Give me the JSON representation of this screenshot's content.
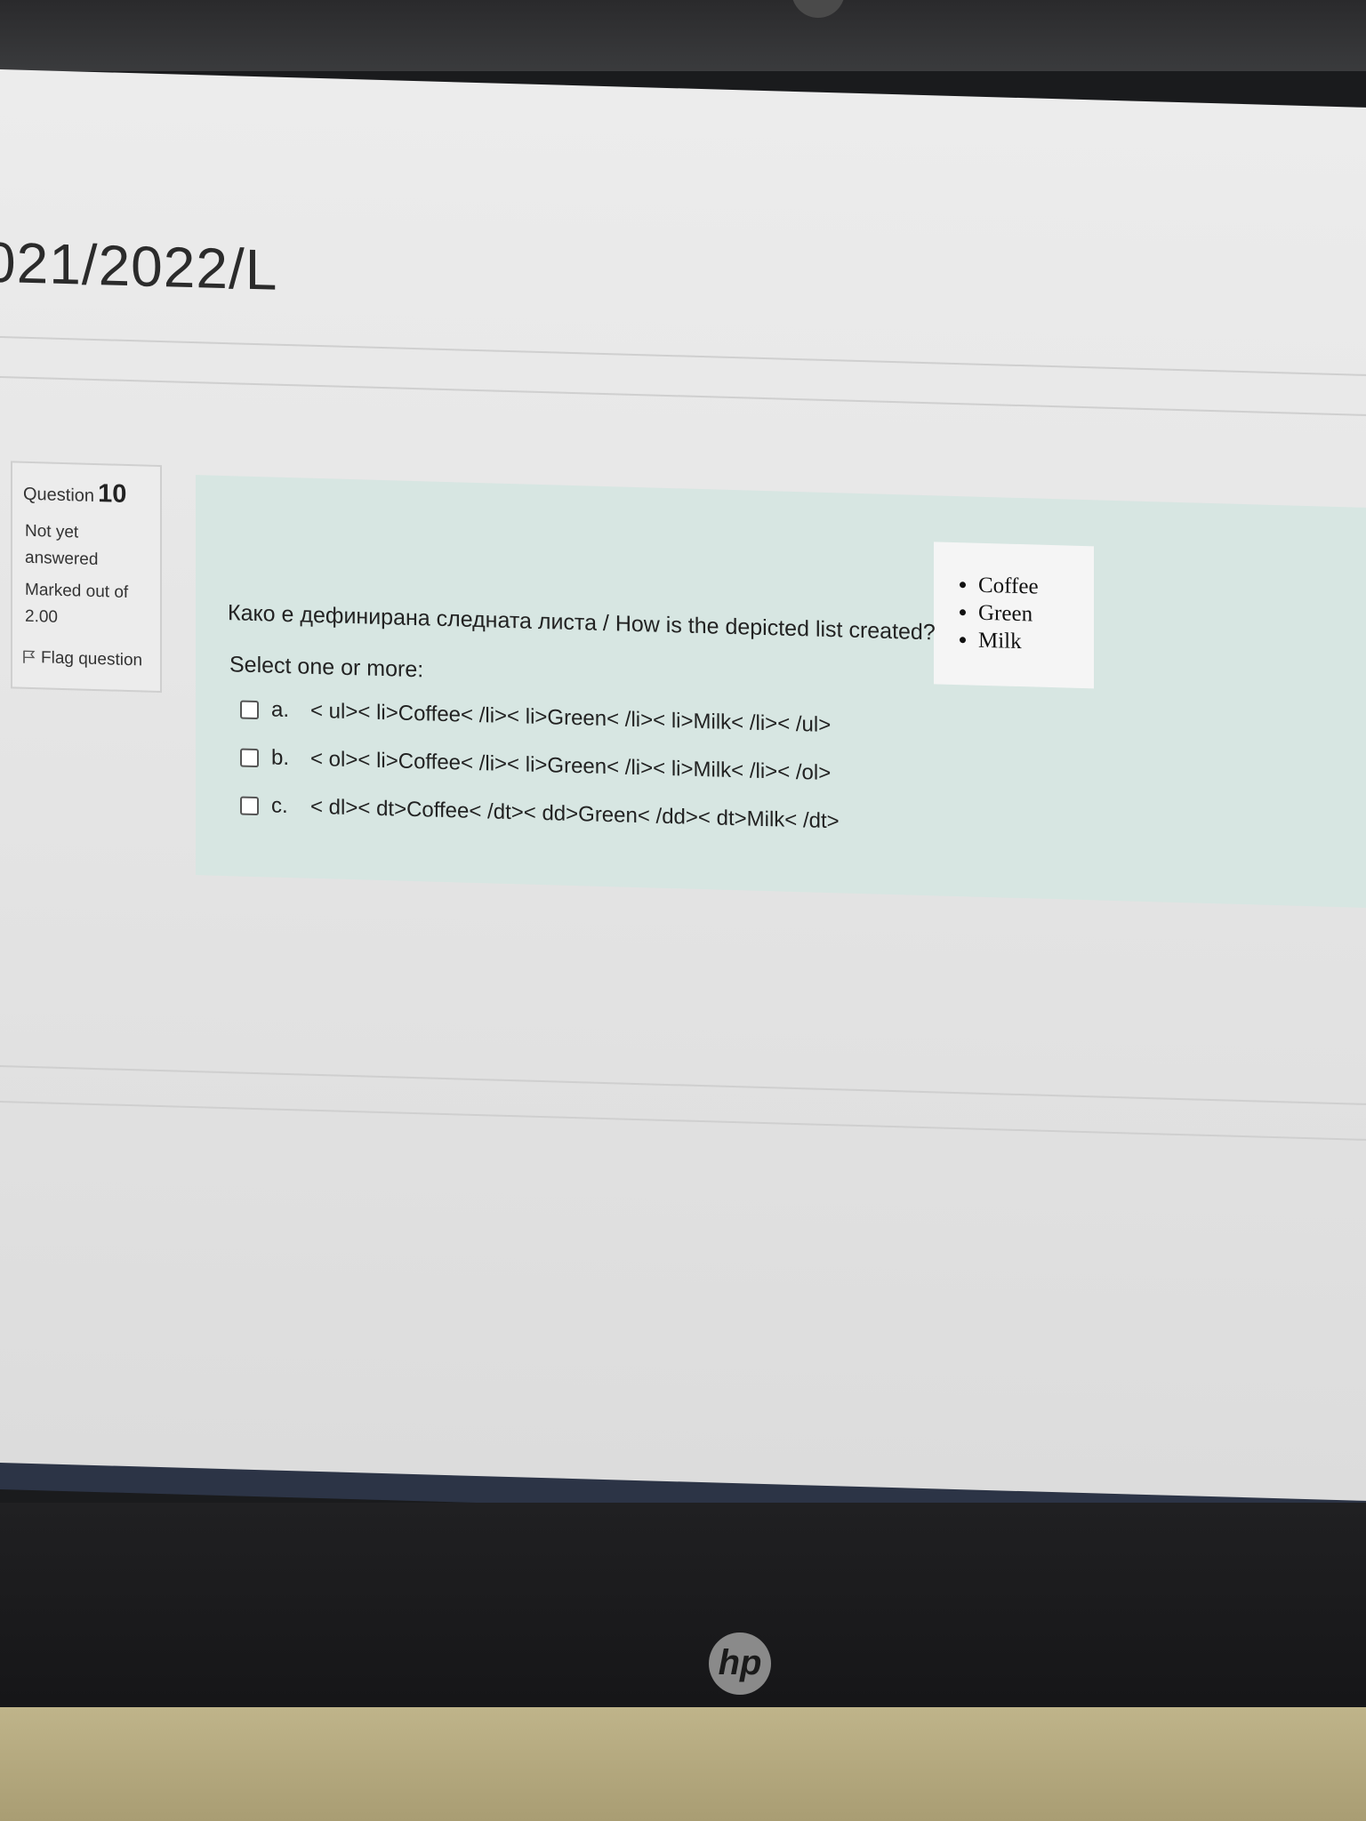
{
  "course": {
    "title_fragment": "021/2022/L"
  },
  "question_info": {
    "label": "Question",
    "number": "10",
    "state_line1": "Not yet",
    "state_line2": "answered",
    "grade_line1": "Marked out of",
    "grade_line2": "2.00",
    "flag_label": "Flag question"
  },
  "question": {
    "prompt": "Како е дефинирана следната листа / How is the depicted list created?",
    "depicted_list": [
      "Coffee",
      "Green",
      "Milk"
    ],
    "select_label": "Select one or more:",
    "answers": [
      {
        "letter": "a.",
        "text": "< ul>< li>Coffee< /li>< li>Green< /li>< li>Milk< /li>< /ul>",
        "checked": false
      },
      {
        "letter": "b.",
        "text": "< ol>< li>Coffee< /li>< li>Green< /li>< li>Milk< /li>< /ol>",
        "checked": false
      },
      {
        "letter": "c.",
        "text": "< dl>< dt>Coffee< /dt>< dd>Green< /dd>< dt>Milk< /dt>",
        "checked": false
      }
    ]
  },
  "device": {
    "logo": "hp"
  }
}
